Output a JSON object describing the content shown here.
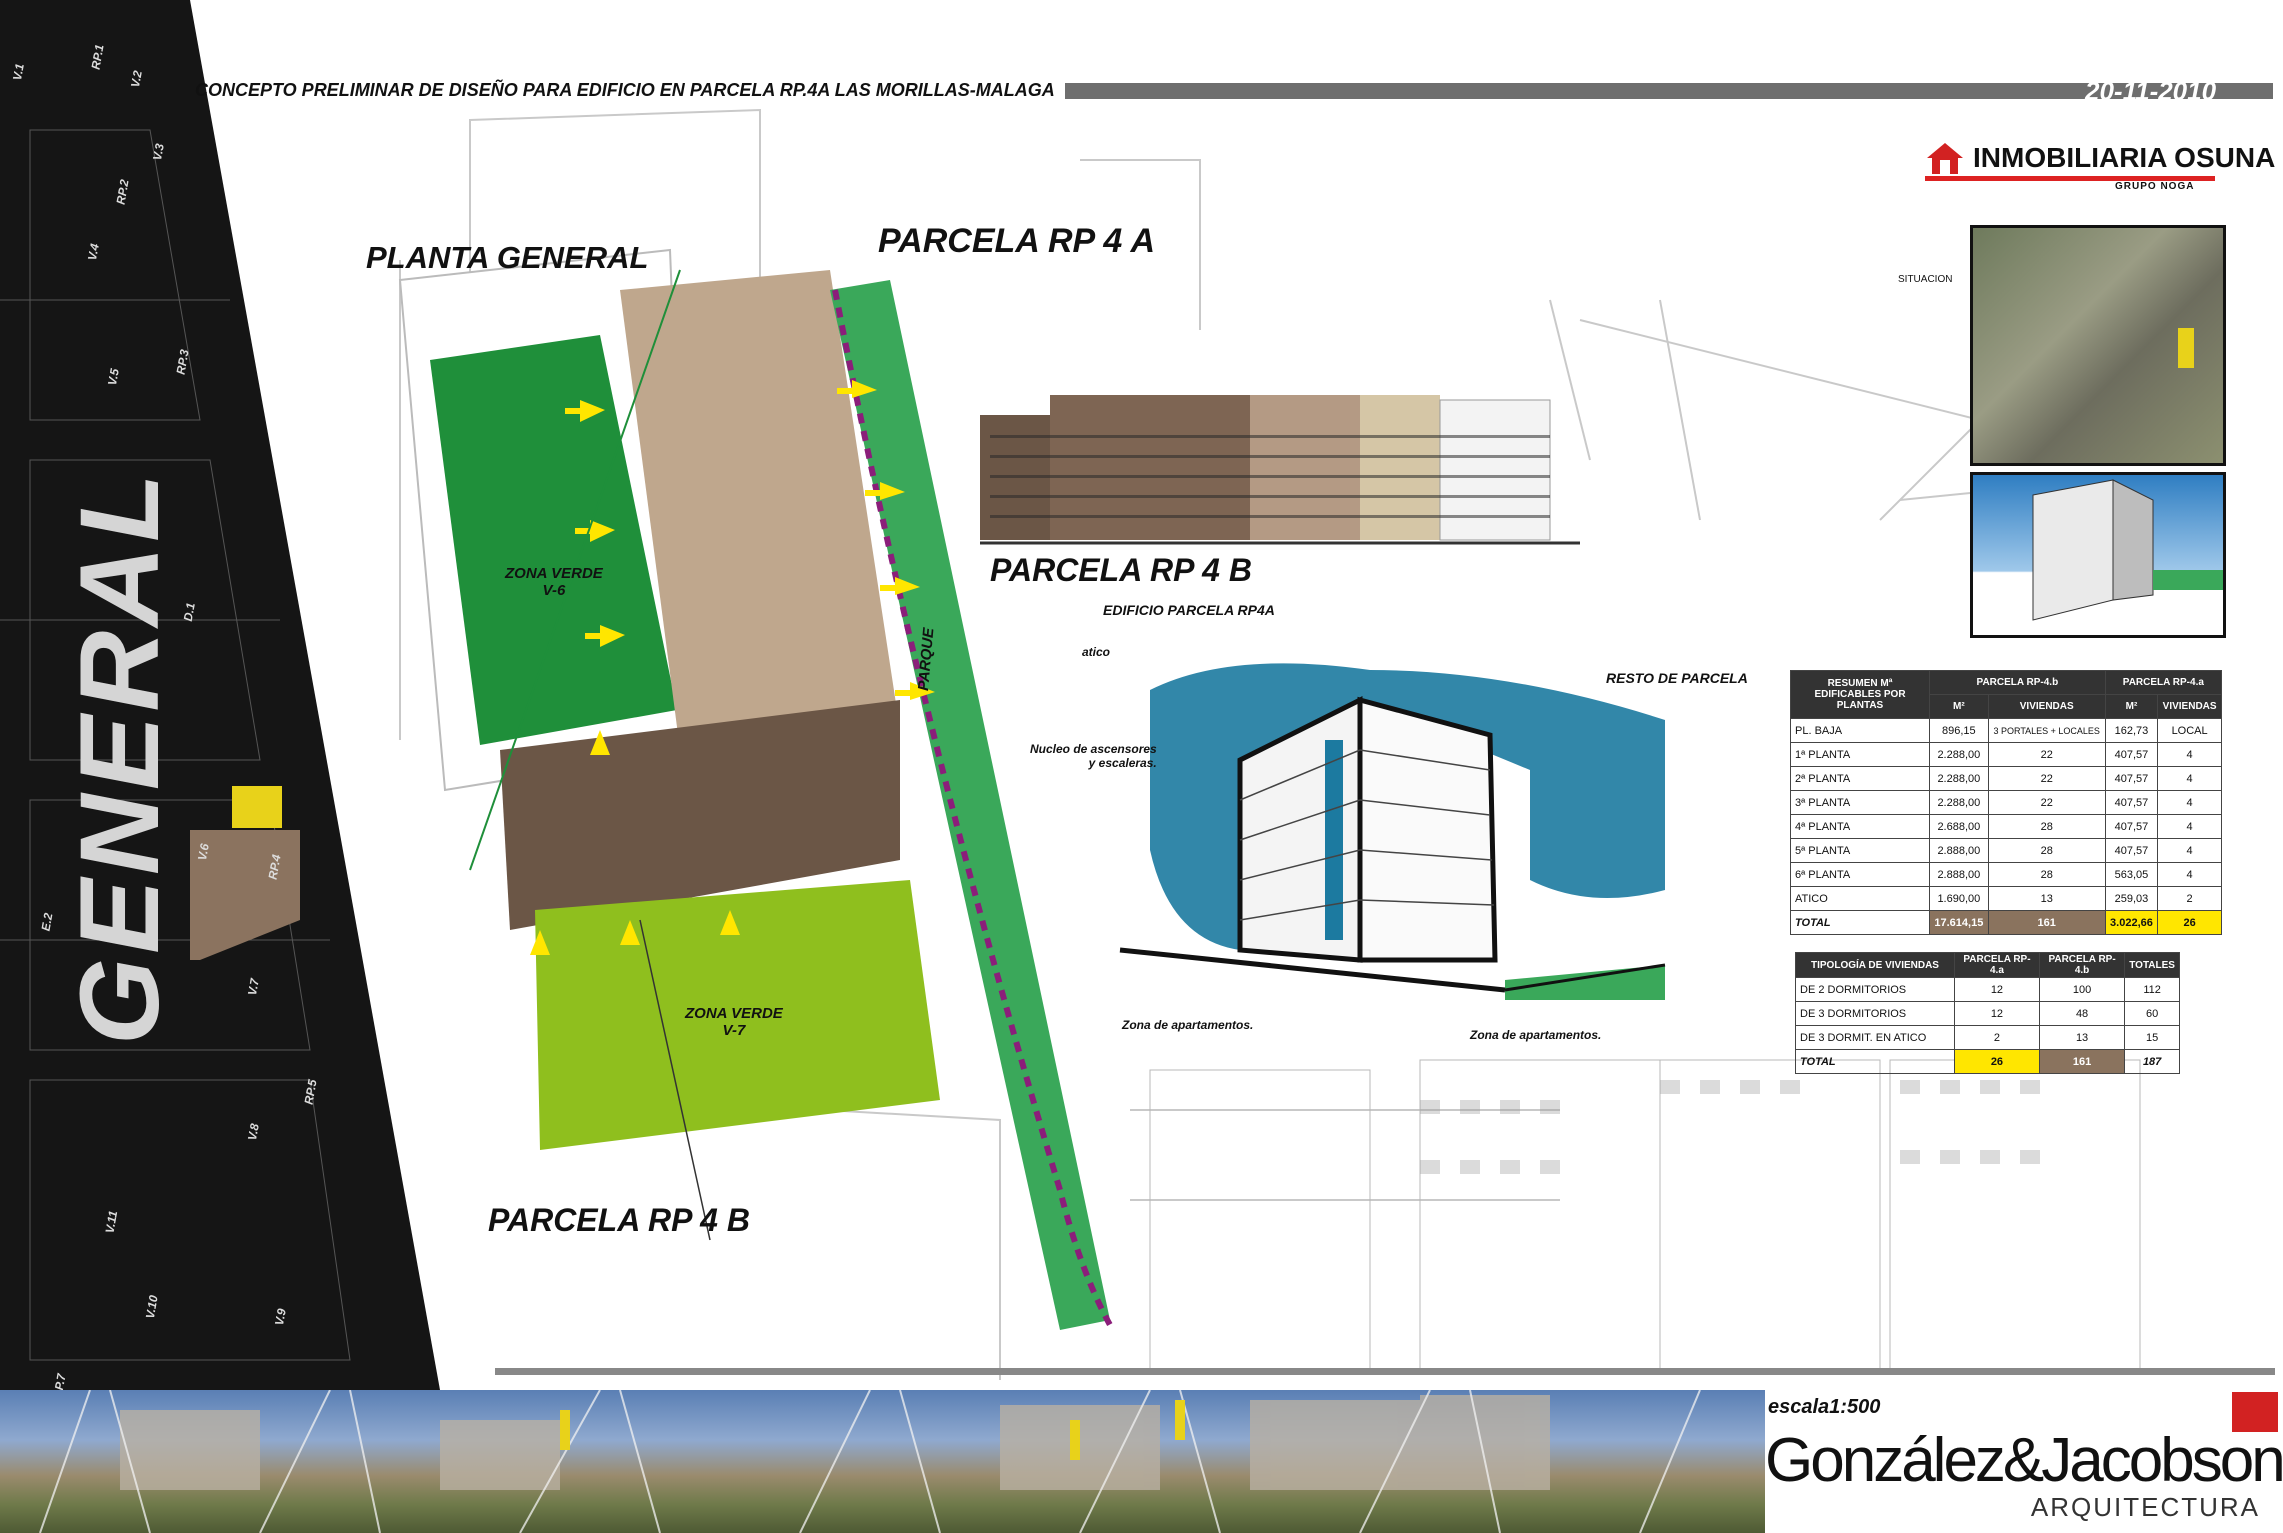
{
  "header": {
    "title": "CONCEPTO PRELIMINAR DE DISEÑO PARA EDIFICIO EN PARCELA RP.4A LAS MORILLAS-MALAGA",
    "date": "20-11-2010"
  },
  "brand": {
    "name": "INMOBILIARIA OSUNA",
    "subtitle": "GRUPO NOGA"
  },
  "side_plan": {
    "big_label": "GENERAL",
    "parcels": [
      "RP.1",
      "RP.2",
      "RP.3",
      "RP.4",
      "RP.5",
      "P.7"
    ],
    "zones": [
      "V.1",
      "V.2",
      "V.3",
      "V.4",
      "V.5",
      "V.6",
      "V.7",
      "V.8",
      "V.9",
      "V.10",
      "V.11",
      "D.1",
      "E.2"
    ]
  },
  "plan": {
    "planta_general": "PLANTA GENERAL",
    "parcela_a": "PARCELA RP 4 A",
    "parcela_b_top": "PARCELA RP 4 B",
    "parcela_b_bottom": "PARCELA RP 4 B",
    "zona_verde_v6": [
      "ZONA VERDE",
      "V-6"
    ],
    "zona_verde_v7": [
      "ZONA VERDE",
      "V-7"
    ],
    "parque": "PARQUE"
  },
  "sketch": {
    "title": "EDIFICIO PARCELA RP4A",
    "atico": "atico",
    "nucleo": [
      "Nucleo de ascensores",
      "y escaleras."
    ],
    "resto": "RESTO DE PARCELA",
    "zona_apart_left": "Zona de apartamentos.",
    "zona_apart_right": "Zona de apartamentos."
  },
  "situacion_label": "SITUACION",
  "summary_table": {
    "header_left": "RESUMEN Mª EDIFICABLES POR PLANTAS",
    "group_b": "PARCELA RP-4.b",
    "group_a": "PARCELA RP-4.a",
    "col_m2": "M²",
    "col_viv": "VIVIENDAS",
    "rows": [
      {
        "label": "PL. BAJA",
        "b_m2": "896,15",
        "b_viv": "3 PORTALES + LOCALES",
        "a_m2": "162,73",
        "a_viv": "LOCAL"
      },
      {
        "label": "1ª PLANTA",
        "b_m2": "2.288,00",
        "b_viv": "22",
        "a_m2": "407,57",
        "a_viv": "4"
      },
      {
        "label": "2ª PLANTA",
        "b_m2": "2.288,00",
        "b_viv": "22",
        "a_m2": "407,57",
        "a_viv": "4"
      },
      {
        "label": "3ª PLANTA",
        "b_m2": "2.288,00",
        "b_viv": "22",
        "a_m2": "407,57",
        "a_viv": "4"
      },
      {
        "label": "4ª PLANTA",
        "b_m2": "2.688,00",
        "b_viv": "28",
        "a_m2": "407,57",
        "a_viv": "4"
      },
      {
        "label": "5ª PLANTA",
        "b_m2": "2.888,00",
        "b_viv": "28",
        "a_m2": "407,57",
        "a_viv": "4"
      },
      {
        "label": "6ª PLANTA",
        "b_m2": "2.888,00",
        "b_viv": "28",
        "a_m2": "563,05",
        "a_viv": "4"
      },
      {
        "label": "ATICO",
        "b_m2": "1.690,00",
        "b_viv": "13",
        "a_m2": "259,03",
        "a_viv": "2"
      }
    ],
    "total": {
      "label": "TOTAL",
      "b_m2": "17.614,15",
      "b_viv": "161",
      "a_m2": "3.022,66",
      "a_viv": "26"
    }
  },
  "typology_table": {
    "col_tipo": "TIPOLOGÍA DE VIVIENDAS",
    "col_a": "PARCELA RP-4.a",
    "col_b": "PARCELA RP-4.b",
    "col_tot": "TOTALES",
    "rows": [
      {
        "label": "DE 2 DORMITORIOS",
        "a": "12",
        "b": "100",
        "t": "112"
      },
      {
        "label": "DE 3 DORMITORIOS",
        "a": "12",
        "b": "48",
        "t": "60"
      },
      {
        "label": "DE 3 DORMIT. EN ATICO",
        "a": "2",
        "b": "13",
        "t": "15"
      }
    ],
    "total": {
      "label": "TOTAL",
      "a": "26",
      "b": "161",
      "t": "187"
    }
  },
  "footer": {
    "escala": "escala1:500",
    "firm_name": "González&Jacobson",
    "firm_sub": "ARQUITECTURA"
  },
  "colors": {
    "dark_green": "#1f8f3a",
    "light_green": "#8fbf1e",
    "park_green": "#3aa85a",
    "purple_path": "#8b1e7a",
    "arrow_yellow": "#ffe600",
    "building_brown": "#6b5646",
    "sketch_blue": "#1c7aa0",
    "brand_red": "#d22222"
  }
}
